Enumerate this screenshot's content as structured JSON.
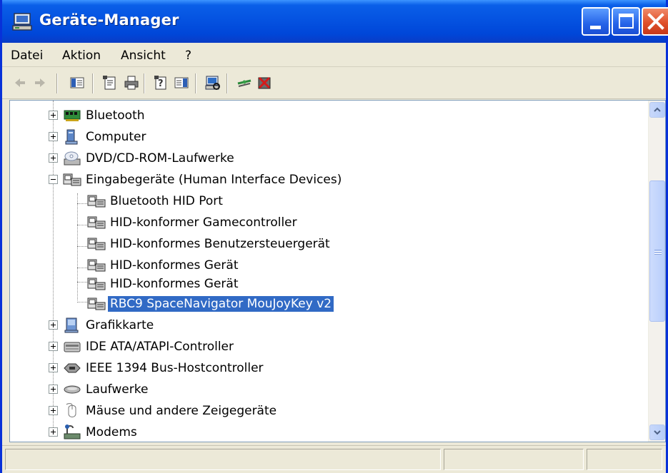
{
  "window": {
    "title": "Geräte-Manager",
    "icon": "computer-monitor-icon",
    "controls": [
      "minimize",
      "maximize",
      "close"
    ]
  },
  "menu": {
    "items": [
      "Datei",
      "Aktion",
      "Ansicht",
      "?"
    ]
  },
  "toolbar": {
    "buttons": [
      {
        "name": "back-icon"
      },
      {
        "name": "forward-icon"
      },
      {
        "name": "show-hide-console-tree-icon"
      },
      {
        "name": "properties-icon"
      },
      {
        "name": "print-icon"
      },
      {
        "name": "help-icon"
      },
      {
        "name": "show-hide-action-pane-icon"
      },
      {
        "name": "scan-hardware-changes-icon"
      },
      {
        "name": "update-driver-icon"
      },
      {
        "name": "uninstall-icon"
      }
    ]
  },
  "tree": {
    "nodes": [
      {
        "label": "Bluetooth",
        "level": 0,
        "expander": "plus",
        "icon": "bluetooth-adapter-icon"
      },
      {
        "label": "Computer",
        "level": 0,
        "expander": "plus",
        "icon": "computer-icon"
      },
      {
        "label": "DVD/CD-ROM-Laufwerke",
        "level": 0,
        "expander": "plus",
        "icon": "cdrom-drive-icon"
      },
      {
        "label": "Eingabegeräte (Human Interface Devices)",
        "level": 0,
        "expander": "minus",
        "icon": "hid-device-icon"
      },
      {
        "label": "Bluetooth HID Port",
        "level": 1,
        "icon": "hid-device-icon"
      },
      {
        "label": "HID-konformer Gamecontroller",
        "level": 1,
        "icon": "hid-device-icon"
      },
      {
        "label": "HID-konformes Benutzersteuergerät",
        "level": 1,
        "icon": "hid-device-icon"
      },
      {
        "label": "HID-konformes Gerät",
        "level": 1,
        "icon": "hid-device-icon"
      },
      {
        "label": "HID-konformes Gerät",
        "level": 1,
        "icon": "hid-device-icon"
      },
      {
        "label": "RBC9 SpaceNavigator MouJoyKey v2",
        "level": 1,
        "icon": "hid-device-icon",
        "selected": true
      },
      {
        "label": "Grafikkarte",
        "level": 0,
        "expander": "plus",
        "icon": "display-adapter-icon"
      },
      {
        "label": "IDE ATA/ATAPI-Controller",
        "level": 0,
        "expander": "plus",
        "icon": "ide-controller-icon"
      },
      {
        "label": "IEEE 1394 Bus-Hostcontroller",
        "level": 0,
        "expander": "plus",
        "icon": "ieee1394-controller-icon"
      },
      {
        "label": "Laufwerke",
        "level": 0,
        "expander": "plus",
        "icon": "disk-drive-icon"
      },
      {
        "label": "Mäuse und andere Zeigegeräte",
        "level": 0,
        "expander": "plus",
        "icon": "mouse-icon"
      },
      {
        "label": "Modems",
        "level": 0,
        "expander": "plus",
        "icon": "modem-icon"
      }
    ]
  },
  "colors": {
    "titlebar": "#0553e1",
    "selection": "#316ac5",
    "window_bg": "#ece9d8"
  }
}
